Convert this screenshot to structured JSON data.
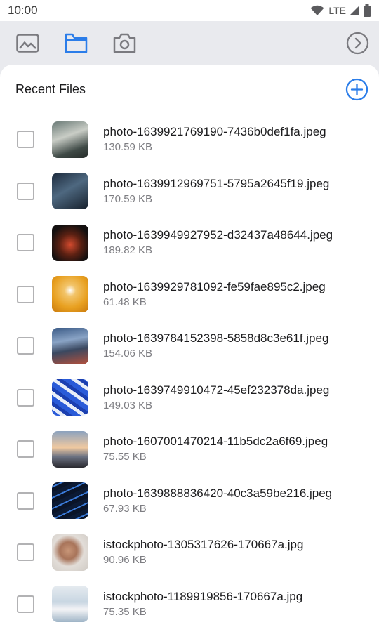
{
  "status_bar": {
    "time": "10:00",
    "network": "LTE"
  },
  "toolbar": {
    "tabs": [
      {
        "icon": "image-icon",
        "active": false
      },
      {
        "icon": "folder-icon",
        "active": true
      },
      {
        "icon": "camera-icon",
        "active": false
      }
    ],
    "next_icon": "chevron-right-circle-icon"
  },
  "colors": {
    "accent": "#2b7de9",
    "icon_gray": "#7a7a7f",
    "background": "#e9eaee"
  },
  "recent": {
    "title": "Recent Files",
    "add_icon": "add-circle-icon",
    "files": [
      {
        "name": "photo-1639921769190-7436b0def1fa.jpeg",
        "size": "130.59 KB",
        "thumb": "linear-gradient(160deg,#6a7a76 0%,#c9cdc6 40%,#3f4a46 75%,#262c2a 100%)"
      },
      {
        "name": "photo-1639912969751-5795a2645f19.jpeg",
        "size": "170.59 KB",
        "thumb": "linear-gradient(150deg,#1c2a3c 0%,#4e6880 45%,#16202c 100%)"
      },
      {
        "name": "photo-1639949927952-d32437a48644.jpeg",
        "size": "189.82 KB",
        "thumb": "radial-gradient(circle at 50% 55%,#d24a2e 0%,#5a2012 40%,#141010 75%)"
      },
      {
        "name": "photo-1639929781092-fe59fae895c2.jpeg",
        "size": "61.48 KB",
        "thumb": "radial-gradient(circle at 50% 40%,#ffffff 0%,#f2c46a 20%,#e8a020 60%,#c8780c 100%)"
      },
      {
        "name": "photo-1639784152398-5858d8c3e61f.jpeg",
        "size": "154.06 KB",
        "thumb": "linear-gradient(170deg,#3a5a86 0%,#8aa4c6 35%,#3a4860 60%,#b4503c 100%)"
      },
      {
        "name": "photo-1639749910472-45ef232378da.jpeg",
        "size": "149.03 KB",
        "thumb": "repeating-linear-gradient(35deg,#2a5bd8 0 7px,#e8eef8 7px 12px,#1b3fb0 12px 17px)"
      },
      {
        "name": "photo-1607001470214-11b5dc2a6f69.jpeg",
        "size": "75.55 KB",
        "thumb": "linear-gradient(180deg,#8ca2be 0%,#f0c9a0 45%,#6c7282 70%,#2a2a30 100%)"
      },
      {
        "name": "photo-1639888836420-40c3a59be216.jpeg",
        "size": "67.93 KB",
        "thumb": "repeating-linear-gradient(-25deg,#0a1428 0 6px,#3a7ad8 6px 8px,#0c1a34 8px 14px)"
      },
      {
        "name": "istockphoto-1305317626-170667a.jpg",
        "size": "90.96 KB",
        "thumb": "radial-gradient(circle at 45% 45%,#c89678 0%,#a8745a 30%,#e2ddd8 55%,#cfcac4 100%)"
      },
      {
        "name": "istockphoto-1189919856-170667a.jpg",
        "size": "75.35 KB",
        "thumb": "linear-gradient(180deg,#e6ebf0 0%,#c8d6e2 45%,#f4f4f6 65%,#9fb4c6 100%)"
      }
    ]
  }
}
